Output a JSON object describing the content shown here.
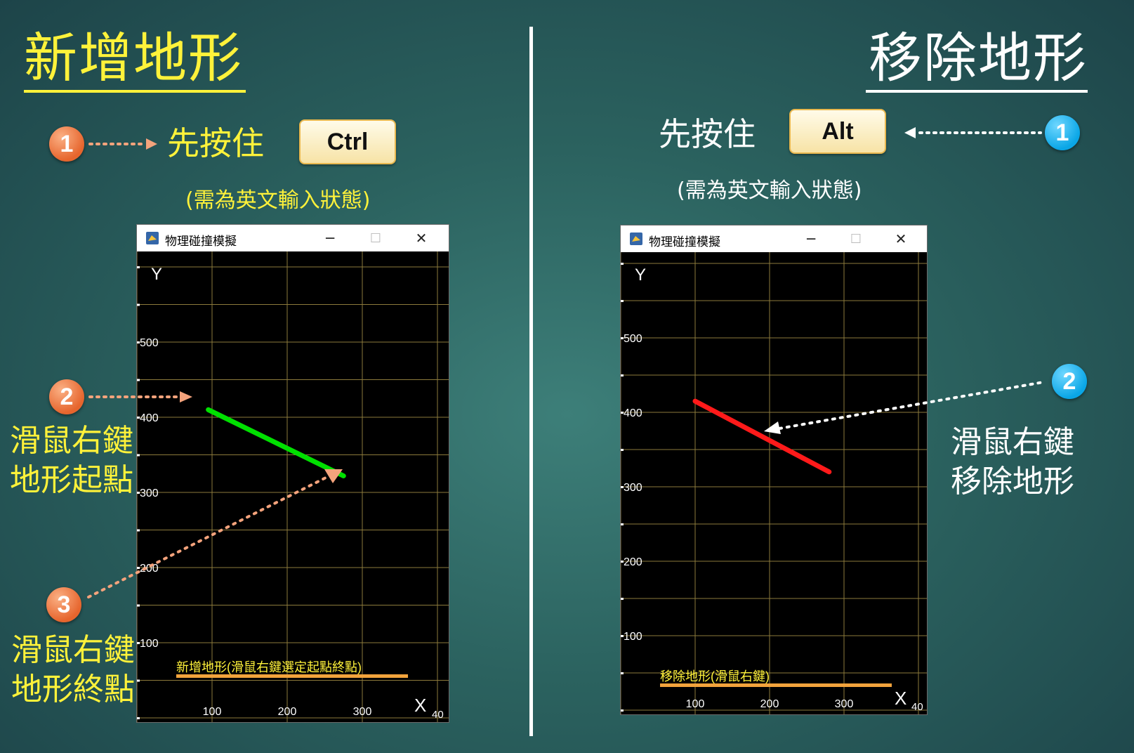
{
  "left_panel": {
    "title": "新增地形",
    "hold_text": "先按住",
    "key": "Ctrl",
    "note": "(需為英文輸入狀態)",
    "steps": [
      {
        "number": "1"
      },
      {
        "number": "2",
        "label_line1": "滑鼠右鍵",
        "label_line2": "地形起點"
      },
      {
        "number": "3",
        "label_line1": "滑鼠右鍵",
        "label_line2": "地形終點"
      }
    ],
    "window": {
      "title": "物理碰撞模擬",
      "y_axis_label": "Y",
      "x_axis_label": "X",
      "y_ticks": [
        "500",
        "400",
        "300",
        "200",
        "100"
      ],
      "x_ticks": [
        "100",
        "200",
        "300"
      ],
      "x_edge_tick": "40",
      "status_text": "新增地形(滑鼠右鍵選定起點終點)",
      "line_color": "#00e000",
      "terrain_line": {
        "x1": 95,
        "y1": 410,
        "x2": 275,
        "y2": 322
      }
    }
  },
  "right_panel": {
    "title": "移除地形",
    "hold_text": "先按住",
    "key": "Alt",
    "note": "(需為英文輸入狀態)",
    "steps": [
      {
        "number": "1"
      },
      {
        "number": "2",
        "label_line1": "滑鼠右鍵",
        "label_line2": "移除地形"
      }
    ],
    "window": {
      "title": "物理碰撞模擬",
      "y_axis_label": "Y",
      "x_axis_label": "X",
      "y_ticks": [
        "500",
        "400",
        "300",
        "200",
        "100"
      ],
      "x_ticks": [
        "100",
        "200",
        "300"
      ],
      "x_edge_tick": "40",
      "status_text": "移除地形(滑鼠右鍵)",
      "line_color": "#ff1a1a",
      "terrain_line": {
        "x1": 100,
        "y1": 415,
        "x2": 280,
        "y2": 320
      }
    }
  },
  "colors": {
    "accent_yellow": "#fff23a",
    "badge_orange": "#e6652d",
    "badge_blue": "#0aa6e6",
    "arrow_orange": "#f4a37c",
    "grid": "#8c7a3c"
  }
}
